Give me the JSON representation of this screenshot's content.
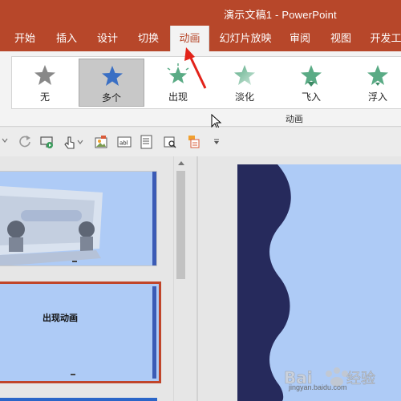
{
  "window": {
    "title": "演示文稿1  -  PowerPoint"
  },
  "tabs": [
    {
      "label": "开始"
    },
    {
      "label": "插入"
    },
    {
      "label": "设计"
    },
    {
      "label": "切换"
    },
    {
      "label": "动画",
      "active": true
    },
    {
      "label": "幻灯片放映"
    },
    {
      "label": "审阅"
    },
    {
      "label": "视图"
    },
    {
      "label": "开发工"
    }
  ],
  "ribbon": {
    "gallery": [
      {
        "label": "无",
        "icon": "star-none-icon",
        "color": "#888888"
      },
      {
        "label": "多个",
        "icon": "star-multiple-icon",
        "color": "#3a6fc4",
        "selected": true
      },
      {
        "label": "出现",
        "icon": "star-appear-icon",
        "color": "#5aab85"
      },
      {
        "label": "淡化",
        "icon": "star-fade-icon",
        "color": "#5aab85"
      },
      {
        "label": "飞入",
        "icon": "star-fly-in-icon",
        "color": "#5aab85"
      },
      {
        "label": "浮入",
        "icon": "star-float-in-icon",
        "color": "#5aab85"
      }
    ],
    "group_label": "动画"
  },
  "slides": {
    "slide2_caption": "出现动画"
  },
  "watermark": {
    "brand": "Baidu经验",
    "url": "jingyan.baidu.com"
  },
  "colors": {
    "accent": "#b7472a",
    "slide_bg": "#aecbf6",
    "slide_wave": "#262a5c",
    "selection_border": "#c0452a"
  }
}
